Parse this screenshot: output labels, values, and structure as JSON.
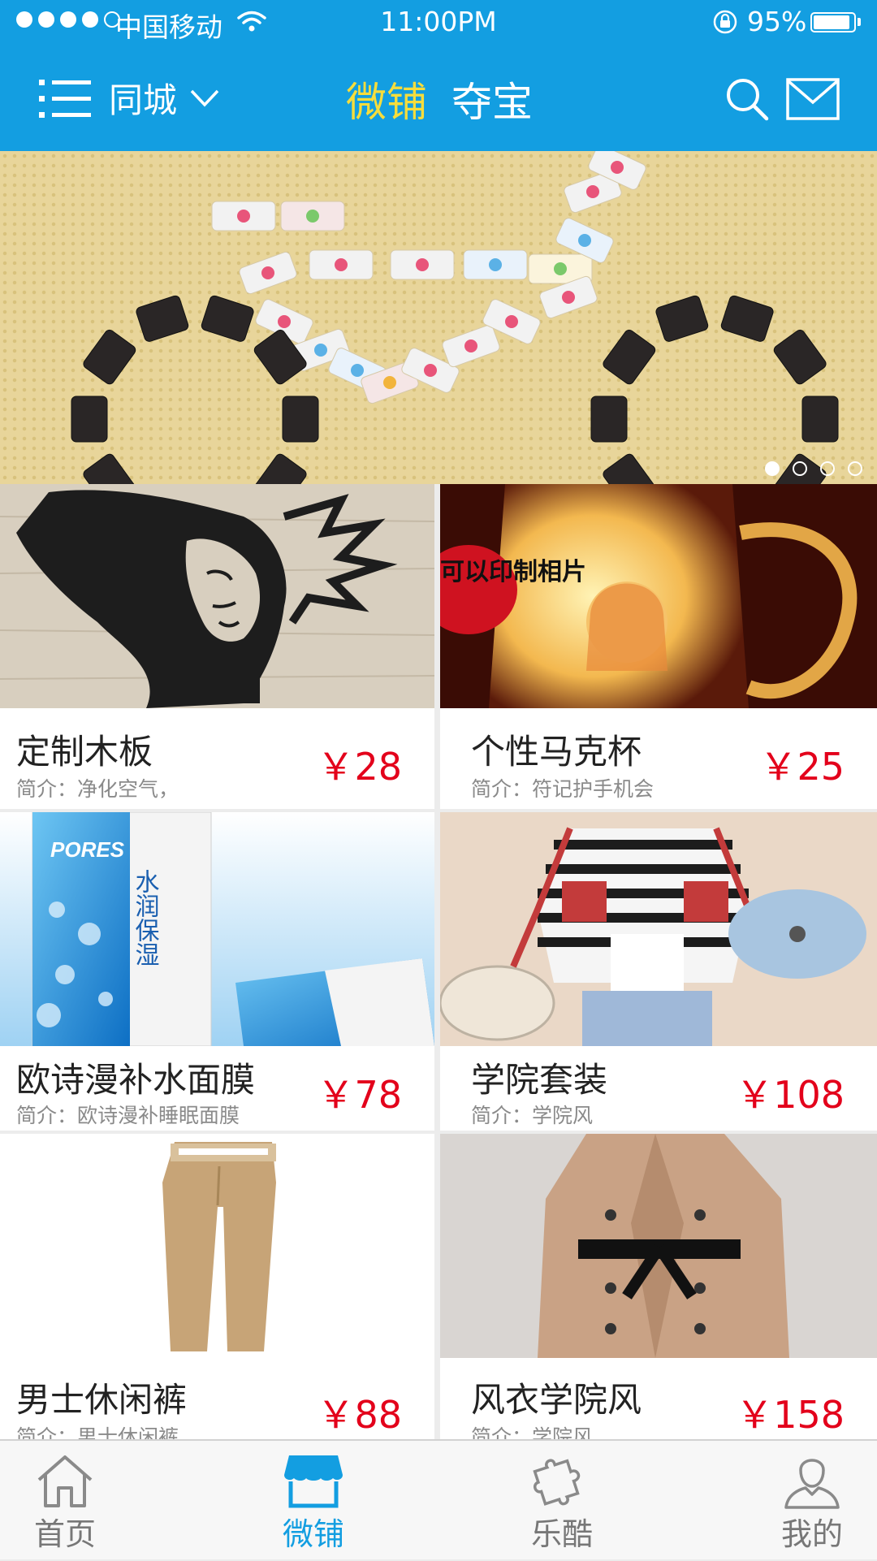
{
  "status_bar": {
    "carrier": "中国移动",
    "time": "11:00PM",
    "battery": "95%"
  },
  "header": {
    "city_label": "同城",
    "tabs": [
      {
        "label": "微铺",
        "active": true
      },
      {
        "label": "夺宝",
        "active": false
      }
    ]
  },
  "banner": {
    "slides": 4,
    "active_slide": 1
  },
  "products": [
    {
      "title": "定制木板",
      "desc": "简介：净化空气，",
      "price": "￥28"
    },
    {
      "title": "个性马克杯",
      "desc": "简介：符记护手机会",
      "price": "￥25",
      "photo_caption": "可以印制相片"
    },
    {
      "title": "欧诗漫补水面膜",
      "desc": "简介：欧诗漫补睡眠面膜",
      "price": "￥78",
      "photo_brand": "PORES",
      "photo_caption": "水润保湿"
    },
    {
      "title": "学院套装",
      "desc": "简介：学院风",
      "price": "￥108"
    },
    {
      "title": "男士休闲裤",
      "desc": "简介：男士休闲裤",
      "price": "￥88"
    },
    {
      "title": "风衣学院风",
      "desc": "简介：学院风",
      "price": "￥158"
    }
  ],
  "bottom_tabs": [
    {
      "label": "首页",
      "icon": "home-icon",
      "active": false
    },
    {
      "label": "微铺",
      "icon": "shop-icon",
      "active": true
    },
    {
      "label": "乐酷",
      "icon": "puzzle-icon",
      "active": false
    },
    {
      "label": "我的",
      "icon": "user-icon",
      "active": false
    }
  ],
  "colors": {
    "header": "#139ee1",
    "active_tab": "#f6dd3c",
    "price": "#e3001b",
    "bottom_active": "#139ee1"
  }
}
